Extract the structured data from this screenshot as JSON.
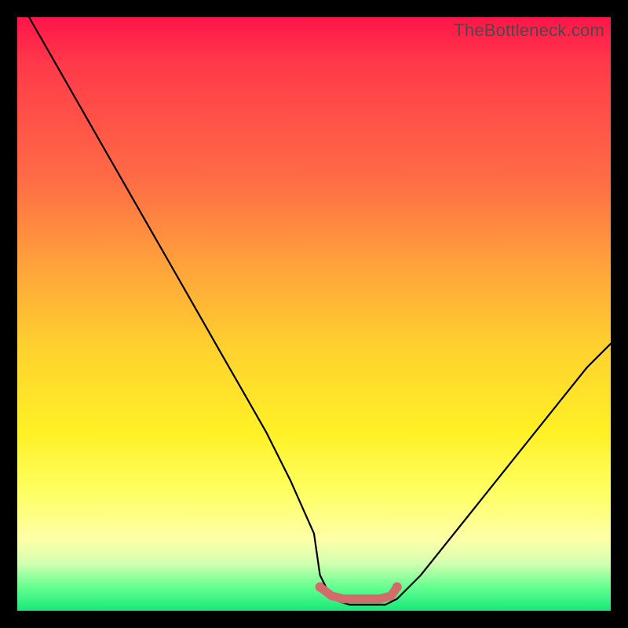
{
  "watermark": "TheBottleneck.com",
  "chart_data": {
    "type": "line",
    "title": "",
    "xlabel": "",
    "ylabel": "",
    "xlim": [
      0,
      100
    ],
    "ylim": [
      0,
      100
    ],
    "series": [
      {
        "name": "bottleneck-curve",
        "x": [
          2,
          6,
          10,
          14,
          18,
          22,
          26,
          30,
          34,
          38,
          42,
          46,
          50,
          51,
          53,
          56,
          59,
          62,
          64,
          68,
          72,
          76,
          80,
          84,
          88,
          92,
          96,
          100
        ],
        "y": [
          100,
          93,
          86,
          79,
          72,
          65,
          58,
          51,
          44,
          37,
          30,
          22,
          13,
          6,
          2,
          1,
          1,
          1,
          2,
          6,
          11,
          16,
          21,
          26,
          31,
          36,
          41,
          45
        ]
      },
      {
        "name": "bottom-band",
        "x": [
          51,
          53,
          55,
          57,
          59,
          61,
          63,
          64
        ],
        "y": [
          4,
          2.5,
          2,
          2,
          2,
          2,
          2.5,
          4
        ]
      }
    ],
    "colors": {
      "curve": "#000000",
      "band": "#d46a6a",
      "gradient_stops": [
        "#ff154a",
        "#ff6e45",
        "#ffd22e",
        "#ffff63",
        "#18e87a"
      ]
    }
  }
}
